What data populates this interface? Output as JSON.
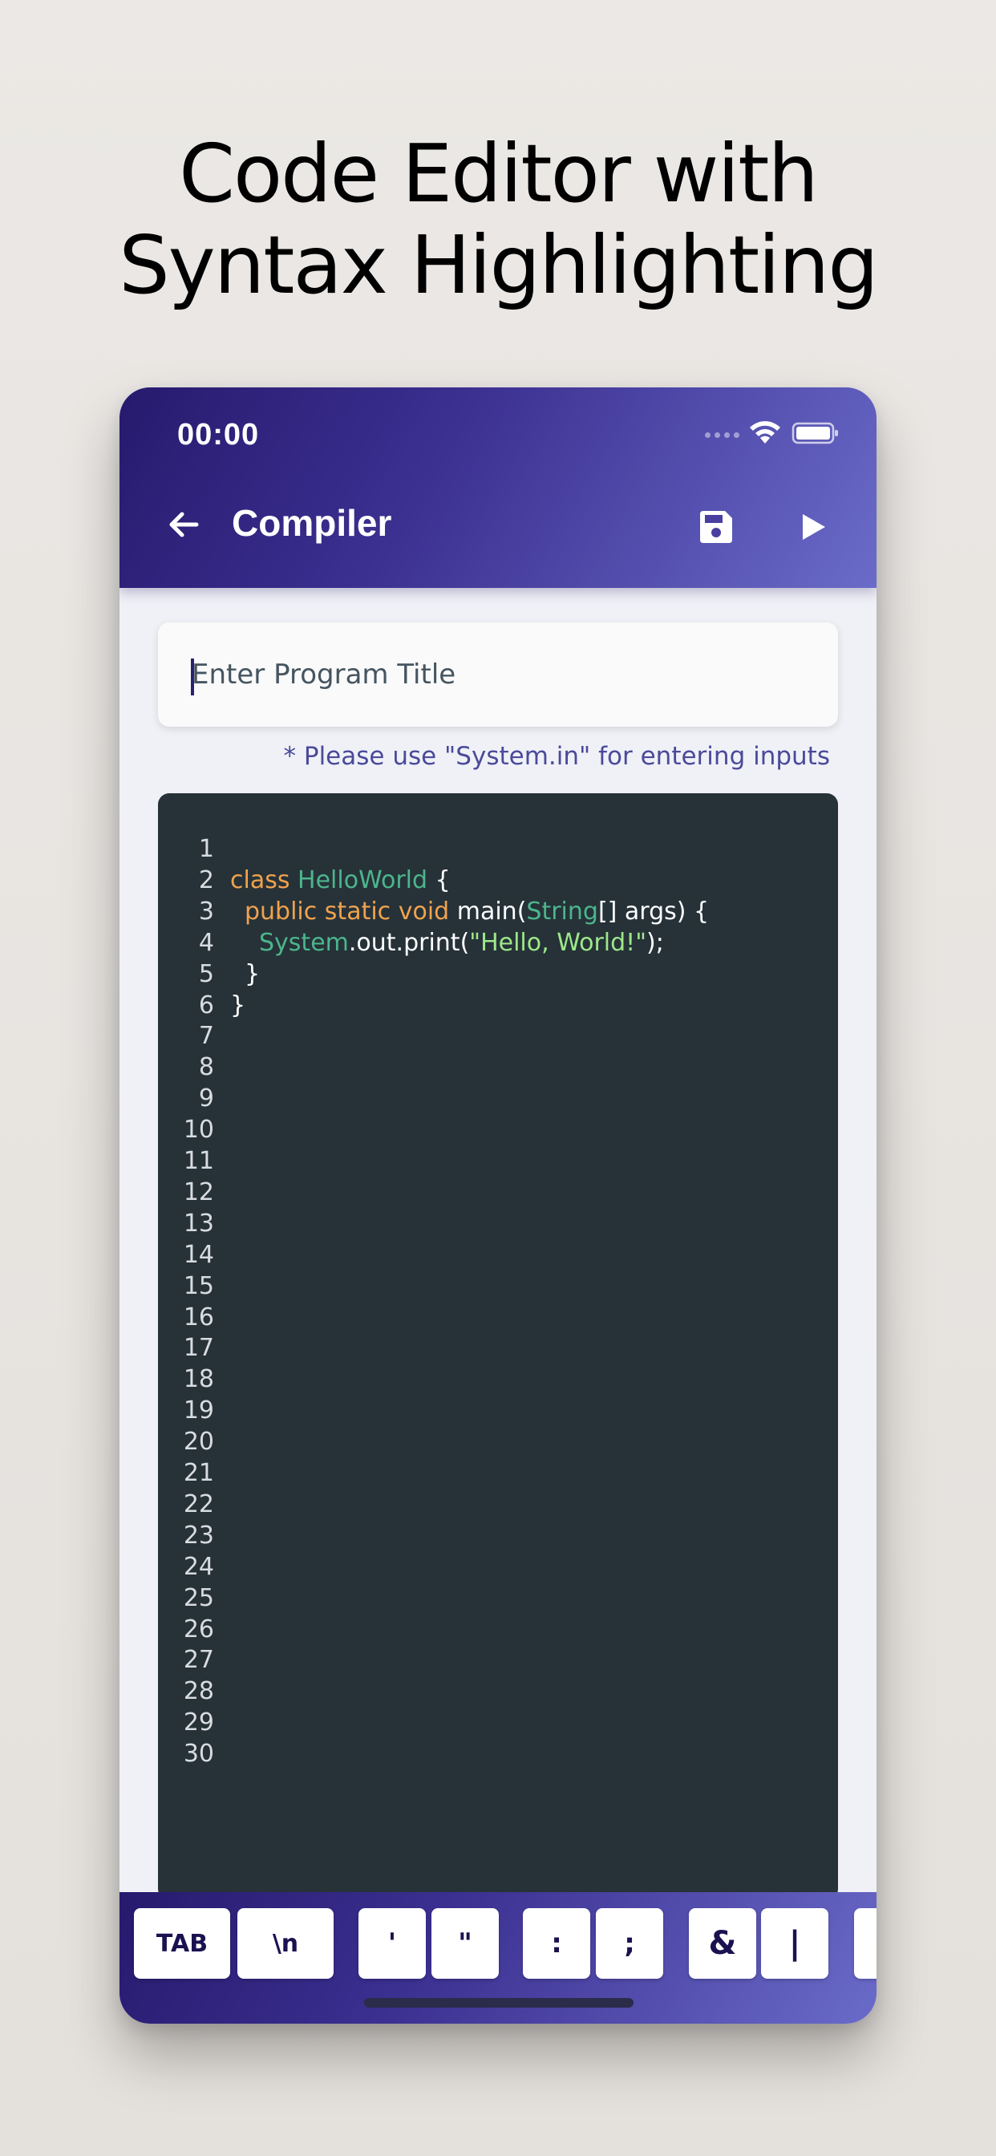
{
  "headline": {
    "line1": "Code Editor with",
    "line2": "Syntax Highlighting"
  },
  "status_bar": {
    "time": "00:00"
  },
  "app_bar": {
    "title": "Compiler",
    "icons": [
      "back-arrow-icon",
      "save-icon",
      "run-play-icon"
    ]
  },
  "title_field": {
    "placeholder": "Enter Program Title",
    "value": ""
  },
  "hint": "* Please use \"System.in\" for entering inputs",
  "editor": {
    "line_numbers": [
      "1",
      "2",
      "3",
      "4",
      "5",
      "6",
      "7",
      "8",
      "9",
      "10",
      "11",
      "12",
      "13",
      "14",
      "15",
      "16",
      "17",
      "18",
      "19",
      "20",
      "21",
      "22",
      "23",
      "24",
      "25",
      "26",
      "27",
      "28",
      "29",
      "30"
    ],
    "code": {
      "l1_kw": "class",
      "l1_cls": "HelloWorld",
      "l1_rest": " {",
      "l2_kw": "public static void",
      "l2_mid": " main(",
      "l2_cls": "String",
      "l2_rest": "[] args) {",
      "l3_cls": "System",
      "l3_mid": ".out.print(",
      "l3_str": "\"Hello, World!\"",
      "l3_rest": ");",
      "l4": "}",
      "l5": "}"
    },
    "colors": {
      "background": "#263238",
      "keyword": "#f0a24e",
      "class": "#4cb58c",
      "string": "#9de88a"
    }
  },
  "shortcut_keys": [
    "TAB",
    "\\n",
    "'",
    "\"",
    ":",
    ";",
    "&",
    "|"
  ],
  "colors": {
    "app_bar_start": "#261a6e",
    "app_bar_end": "#6a6bc9",
    "hint": "#4a4a9a"
  }
}
